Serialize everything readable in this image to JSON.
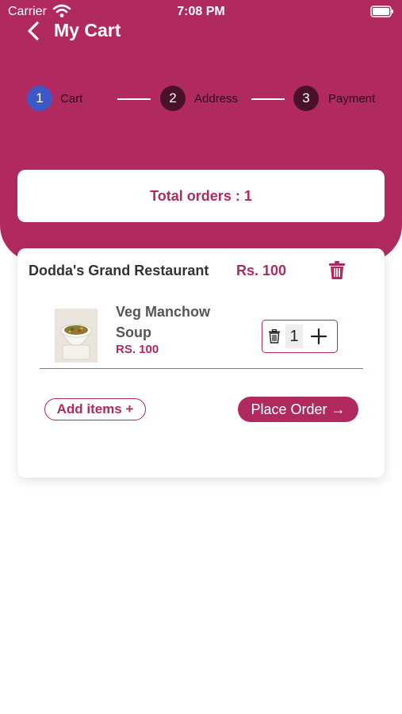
{
  "colors": {
    "brand": "#b02a60",
    "step_active": "#3f58c7",
    "step_inactive": "#4a1228",
    "white": "#ffffff"
  },
  "status_bar": {
    "carrier": "Carrier",
    "time": "7:08 PM"
  },
  "header": {
    "title": "My Cart",
    "back_icon": "chevron-left-icon"
  },
  "steps": [
    {
      "number": "1",
      "label": "Cart"
    },
    {
      "number": "2",
      "label": "Address"
    },
    {
      "number": "3",
      "label": "Payment"
    }
  ],
  "summary": {
    "total_orders": "Total orders : 1"
  },
  "order": {
    "restaurant": "Dodda's Grand Restaurant",
    "price": "Rs. 100",
    "item": {
      "name": "Veg Manchow Soup",
      "price": "RS. 100",
      "quantity": "1"
    },
    "add_items_label": "Add items +",
    "place_order_label": "Place Order →"
  }
}
